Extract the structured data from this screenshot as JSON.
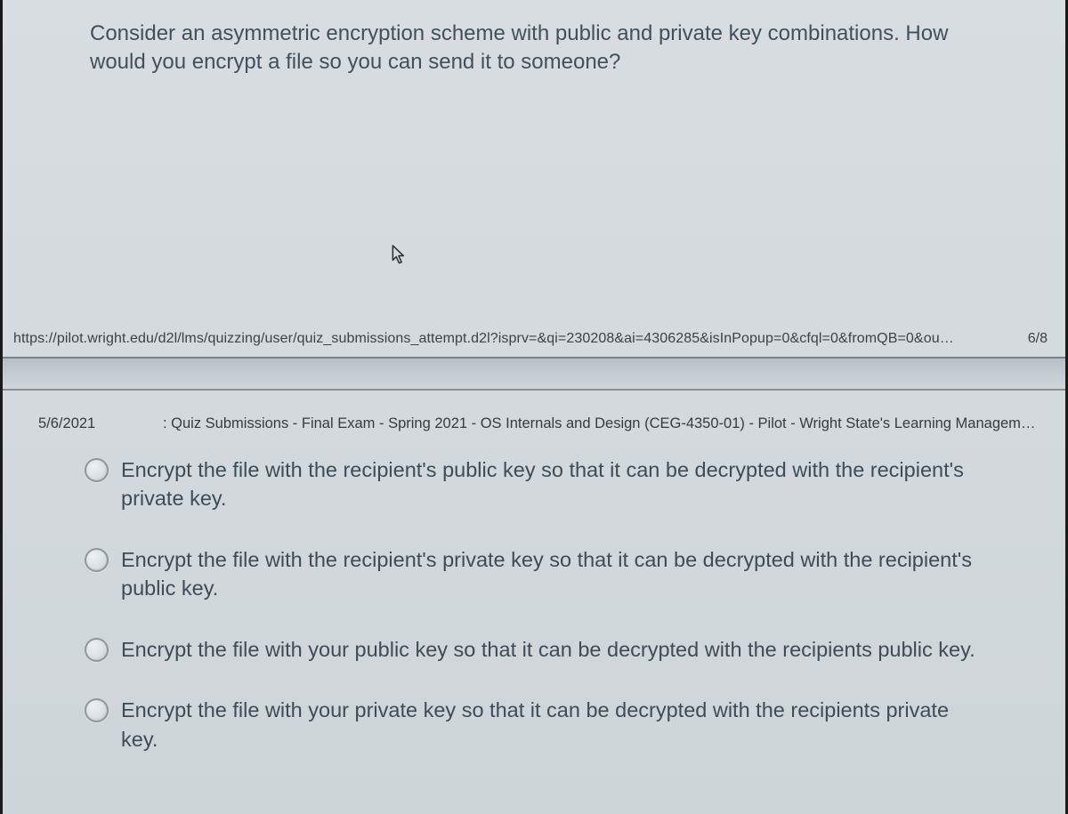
{
  "question": "Consider an asymmetric encryption scheme with public and private key combinations. How would you encrypt a file so you can send it to someone?",
  "footer": {
    "url": "https://pilot.wright.edu/d2l/lms/quizzing/user/quiz_submissions_attempt.d2l?isprv=&qi=230208&ai=4306285&isInPopup=0&cfql=0&fromQB=0&ou…",
    "page": "6/8"
  },
  "meta": {
    "date": "5/6/2021",
    "title": ": Quiz Submissions - Final Exam - Spring 2021 - OS Internals and Design (CEG-4350-01) - Pilot - Wright State's Learning Manageme…"
  },
  "options": [
    "Encrypt the file with the recipient's public key so that it can be decrypted with the recipient's private key.",
    "Encrypt the file with the recipient's private key so that it can be decrypted with the recipient's public key.",
    "Encrypt the file with your public key so that it can be decrypted with the recipients public key.",
    "Encrypt the file with your private key so that it can be decrypted with the recipients private key."
  ]
}
